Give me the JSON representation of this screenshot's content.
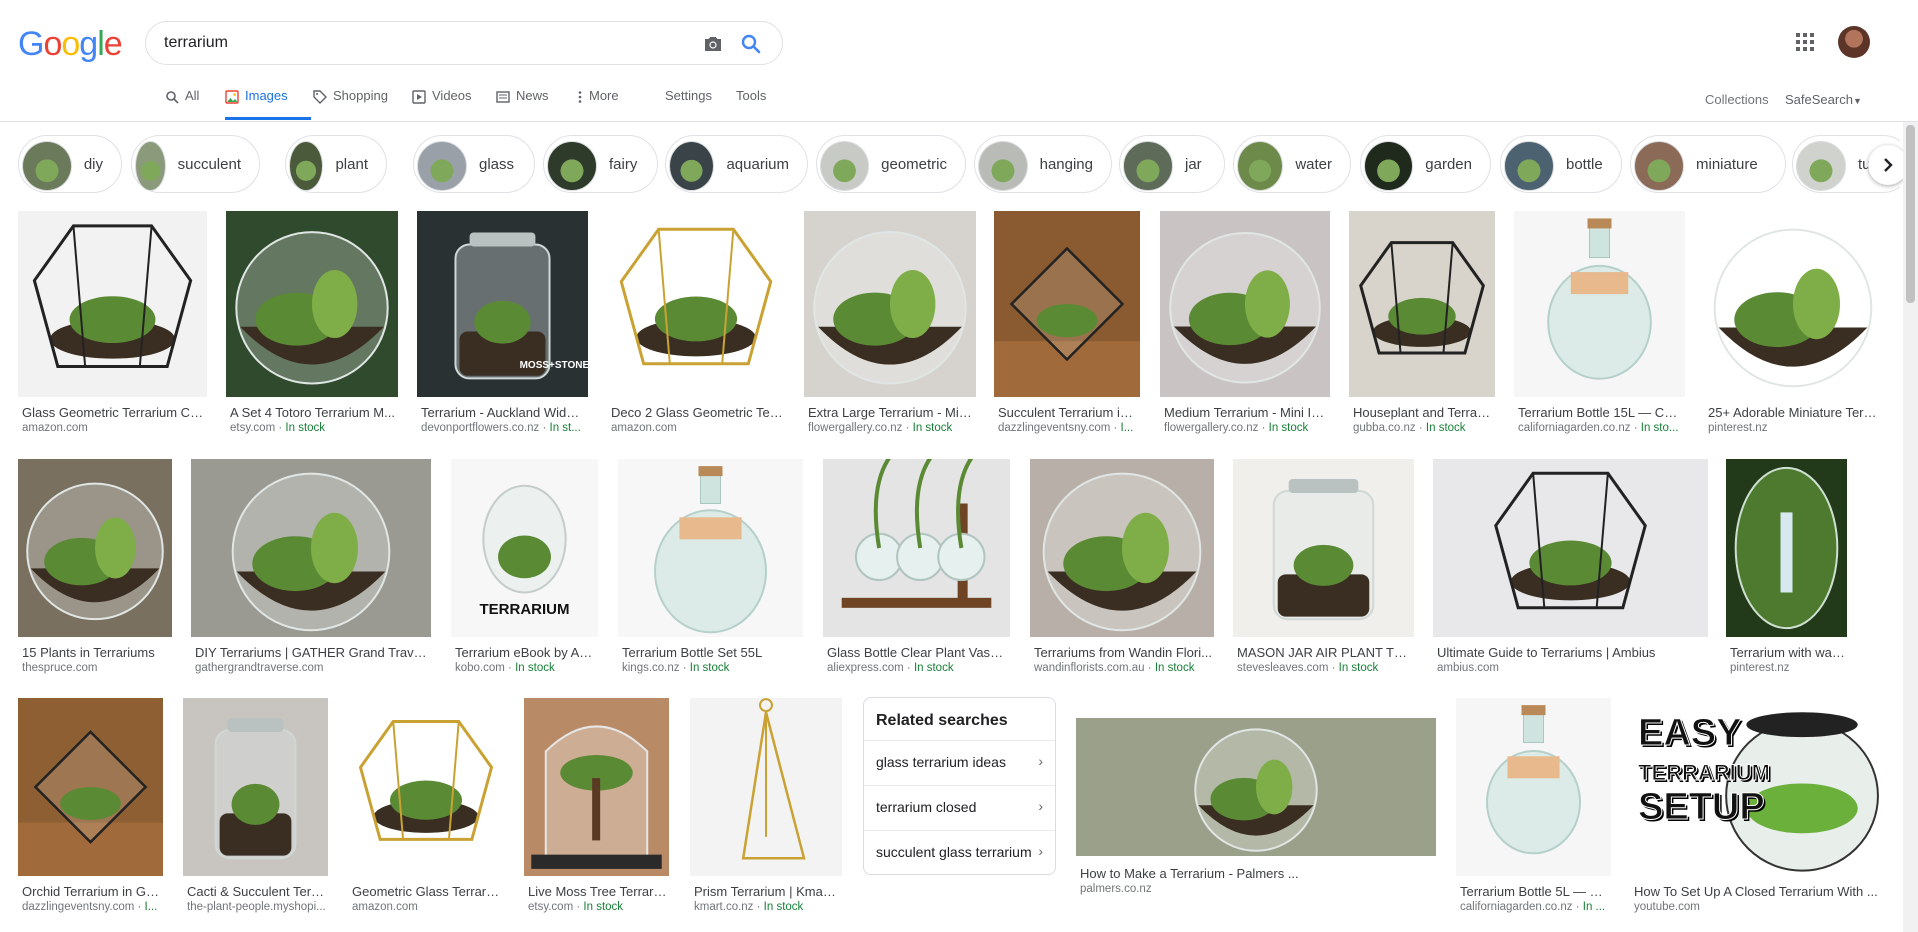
{
  "logo": {
    "text": "Google"
  },
  "search": {
    "query": "terrarium"
  },
  "tabs": {
    "all": "All",
    "images": "Images",
    "shopping": "Shopping",
    "videos": "Videos",
    "news": "News",
    "more": "More",
    "settings": "Settings",
    "tools": "Tools"
  },
  "right_tools": {
    "collections": "Collections",
    "safesearch": "SafeSearch"
  },
  "chips": [
    "diy",
    "succulent",
    "plant",
    "glass",
    "fairy",
    "aquarium",
    "geometric",
    "hanging",
    "jar",
    "water",
    "garden",
    "bottle",
    "miniature",
    "tur"
  ],
  "results": [
    {
      "title": "Glass Geometric Terrarium Con...",
      "source": "amazon.com",
      "stock": ""
    },
    {
      "title": "A Set 4 Totoro Terrarium M...",
      "source": "etsy.com",
      "stock": "In stock"
    },
    {
      "title": "Terrarium - Auckland Wide ...",
      "source": "devonportflowers.co.nz",
      "stock": "In st..."
    },
    {
      "title": "Deco 2 Glass Geometric Terr...",
      "source": "amazon.com",
      "stock": ""
    },
    {
      "title": "Extra Large Terrarium - Mini...",
      "source": "flowergallery.co.nz",
      "stock": "In stock"
    },
    {
      "title": "Succulent Terrarium in ...",
      "source": "dazzlingeventsny.com",
      "stock": "I..."
    },
    {
      "title": "Medium Terrarium - Mini In...",
      "source": "flowergallery.co.nz",
      "stock": "In stock"
    },
    {
      "title": "Houseplant and Terrari...",
      "source": "gubba.co.nz",
      "stock": "In stock"
    },
    {
      "title": "Terrarium Bottle 15L — Cali...",
      "source": "californiagarden.co.nz",
      "stock": "In sto..."
    },
    {
      "title": "25+ Adorable Miniature Terra...",
      "source": "pinterest.nz",
      "stock": ""
    },
    {
      "title": "15 Plants in Terrariums",
      "source": "thespruce.com",
      "stock": ""
    },
    {
      "title": "DIY Terrariums | GATHER Grand Traverse",
      "source": "gathergrandtraverse.com",
      "stock": ""
    },
    {
      "title": "Terrarium eBook by An...",
      "source": "kobo.com",
      "stock": "In stock"
    },
    {
      "title": "Terrarium Bottle Set 55L",
      "source": "kings.co.nz",
      "stock": "In stock"
    },
    {
      "title": "Glass Bottle Clear Plant Vase ...",
      "source": "aliexpress.com",
      "stock": "In stock"
    },
    {
      "title": "Terrariums from Wandin Flori...",
      "source": "wandinflorists.com.au",
      "stock": "In stock"
    },
    {
      "title": "MASON JAR AIR PLANT TER...",
      "source": "stevesleaves.com",
      "stock": "In stock"
    },
    {
      "title": "Ultimate Guide to Terrariums | Ambius",
      "source": "ambius.com",
      "stock": ""
    },
    {
      "title": "Terrarium with waterfall ...",
      "source": "pinterest.nz",
      "stock": ""
    },
    {
      "title": "Orchid Terrarium in Gre...",
      "source": "dazzlingeventsny.com",
      "stock": "I..."
    },
    {
      "title": "Cacti & Succulent Terra...",
      "source": "the-plant-people.myshopi...",
      "stock": ""
    },
    {
      "title": "Geometric Glass Terrariu...",
      "source": "amazon.com",
      "stock": ""
    },
    {
      "title": "Live Moss Tree Terrariu...",
      "source": "etsy.com",
      "stock": "In stock"
    },
    {
      "title": "Prism Terrarium | Kmart...",
      "source": "kmart.co.nz",
      "stock": "In stock"
    },
    {
      "title": "How to Make a Terrarium - Palmers ...",
      "source": "palmers.co.nz",
      "stock": ""
    },
    {
      "title": "Terrarium Bottle 5L — Ca...",
      "source": "californiagarden.co.nz",
      "stock": "In ..."
    },
    {
      "title": "How To Set Up A Closed Terrarium With ...",
      "source": "youtube.com",
      "stock": ""
    }
  ],
  "image_text": {
    "moss_stone": "MOSS+STONE",
    "ebook_cover": "TERRARIUM",
    "easy_title": "EASY",
    "easy_sub": "TERRARIUM",
    "easy_setup": "SETUP"
  },
  "related": {
    "heading": "Related searches",
    "items": [
      "glass terrarium ideas",
      "terrarium closed",
      "succulent glass terrarium"
    ]
  },
  "colors": {
    "accent": "#1a73e8",
    "stock": "#188038",
    "text_secondary": "#70757a"
  }
}
